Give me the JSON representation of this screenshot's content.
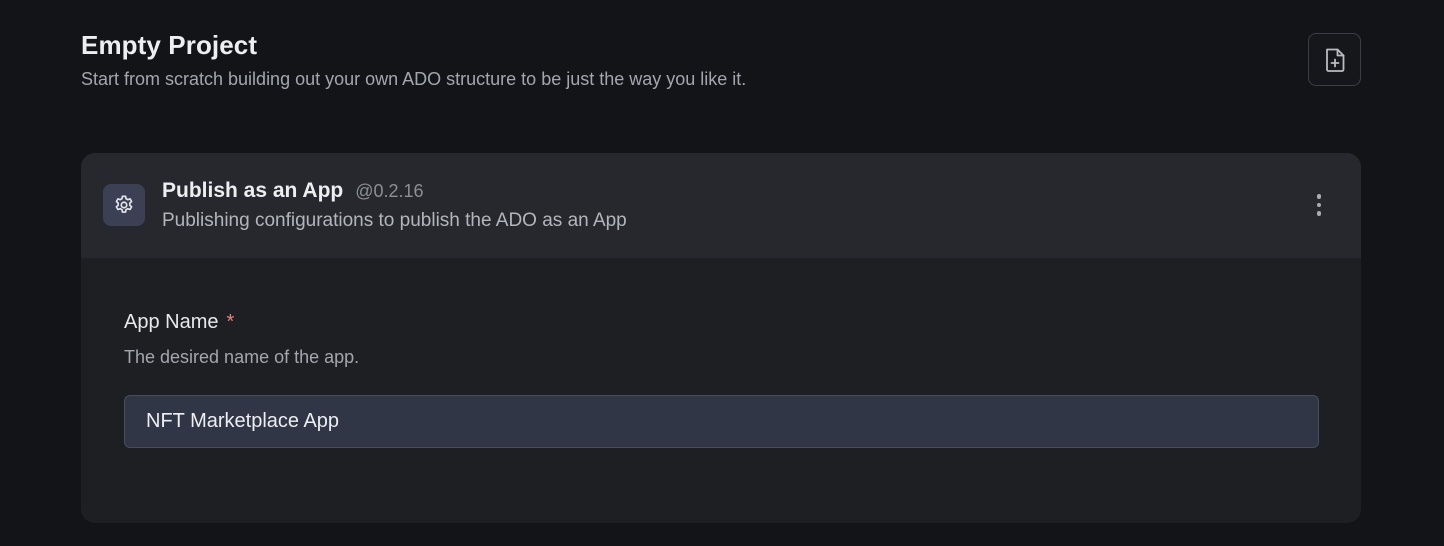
{
  "header": {
    "title": "Empty Project",
    "subtitle": "Start from scratch building out your own ADO structure to be just the way you like it.",
    "new_file_icon": "file-plus-icon"
  },
  "card": {
    "icon": "gear-icon",
    "title": "Publish as an App",
    "version": "@0.2.16",
    "description": "Publishing configurations to publish the ADO as an App",
    "menu_icon": "more-vertical-icon",
    "field": {
      "label": "App Name",
      "required_mark": "*",
      "help": "The desired name of the app.",
      "value": "NFT Marketplace App",
      "placeholder": ""
    }
  },
  "colors": {
    "background": "#131418",
    "card": "#1e1f23",
    "card_header": "#27282d",
    "input": "#303645",
    "required": "#f0807a"
  }
}
